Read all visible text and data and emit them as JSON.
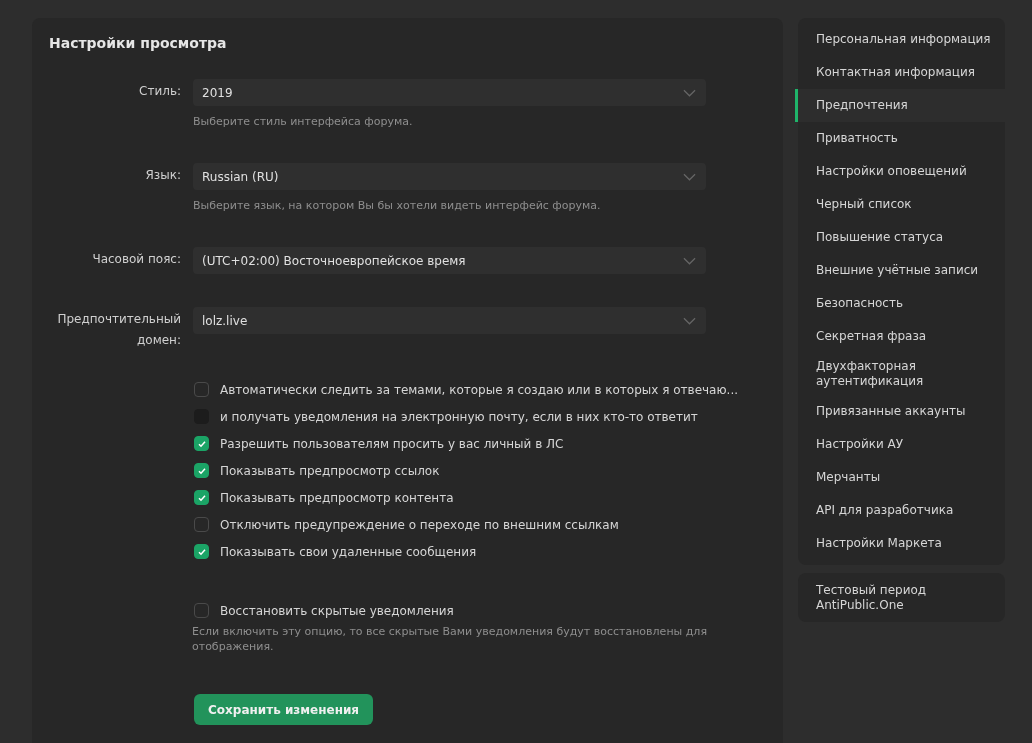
{
  "panel": {
    "title": "Настройки просмотра"
  },
  "fields": [
    {
      "label": "Стиль:",
      "value": "2019",
      "hint": "Выберите стиль интерфейса форума."
    },
    {
      "label": "Язык:",
      "value": "Russian (RU)",
      "hint": "Выберите язык, на котором Вы бы хотели видеть интерфейс форума."
    },
    {
      "label": "Часовой пояс:",
      "value": "(UTC+02:00) Восточноевропейское время"
    },
    {
      "label": "Предпочтительный домен:",
      "value": "lolz.live"
    }
  ],
  "options": [
    {
      "label": "Автоматически следить за темами, которые я создаю или в которых я отвечаю...",
      "checked": false,
      "disabled": false
    },
    {
      "label": "и получать уведомления на электронную почту, если в них кто-то ответит",
      "checked": false,
      "disabled": true
    },
    {
      "label": "Разрешить пользователям просить у вас личный в ЛС",
      "checked": true,
      "disabled": false
    },
    {
      "label": "Показывать предпросмотр ссылок",
      "checked": true,
      "disabled": false
    },
    {
      "label": "Показывать предпросмотр контента",
      "checked": true,
      "disabled": false
    },
    {
      "label": "Отключить предупреждение о переходе по внешним ссылкам",
      "checked": false,
      "disabled": false
    },
    {
      "label": "Показывать свои удаленные сообщения",
      "checked": true,
      "disabled": false
    }
  ],
  "restore": {
    "label": "Восстановить скрытые уведомления",
    "checked": false,
    "hint": "Если включить эту опцию, то все скрытые Вами уведомления будут восстановлены для отображения."
  },
  "save_button": "Сохранить изменения",
  "sidebar": {
    "items": [
      {
        "label": "Персональная информация",
        "selected": false
      },
      {
        "label": "Контактная информация",
        "selected": false
      },
      {
        "label": "Предпочтения",
        "selected": true
      },
      {
        "label": "Приватность",
        "selected": false
      },
      {
        "label": "Настройки оповещений",
        "selected": false
      },
      {
        "label": "Черный список",
        "selected": false
      },
      {
        "label": "Повышение статуса",
        "selected": false
      },
      {
        "label": "Внешние учётные записи",
        "selected": false
      },
      {
        "label": "Безопасность",
        "selected": false
      },
      {
        "label": "Секретная фраза",
        "selected": false
      },
      {
        "label": "Двухфакторная аутентификация",
        "selected": false
      },
      {
        "label": "Привязанные аккаунты",
        "selected": false
      },
      {
        "label": "Настройки АУ",
        "selected": false
      },
      {
        "label": "Мерчанты",
        "selected": false
      },
      {
        "label": "API для разработчика",
        "selected": false
      },
      {
        "label": "Настройки Маркета",
        "selected": false
      }
    ],
    "extra": {
      "label": "Тестовый период AntiPublic.One",
      "selected": false
    }
  }
}
